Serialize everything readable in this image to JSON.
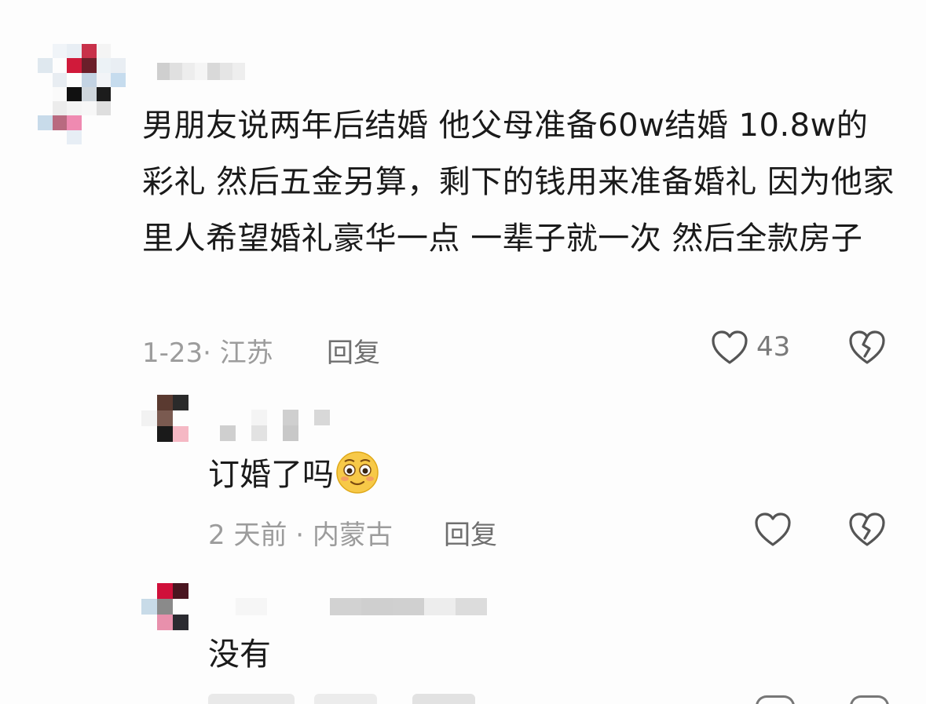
{
  "comment": {
    "text": "男朋友说两年后结婚 他父母准备60w结婚 10.8w的彩礼 然后五金另算，剩下的钱用来准备婚礼 因为他家里人希望婚礼豪华一点 一辈子就一次 然后全款房子",
    "meta": "1-23· 江苏",
    "reply_label": "回复",
    "like_count": "43"
  },
  "replies": [
    {
      "text": "订婚了吗",
      "meta": "2 天前 · 内蒙古",
      "reply_label": "回复"
    },
    {
      "text": "没有"
    }
  ],
  "icons": {
    "like": "heart-outline-icon",
    "dislike": "broken-heart-icon",
    "emoji": "smiling-face-emoji"
  }
}
